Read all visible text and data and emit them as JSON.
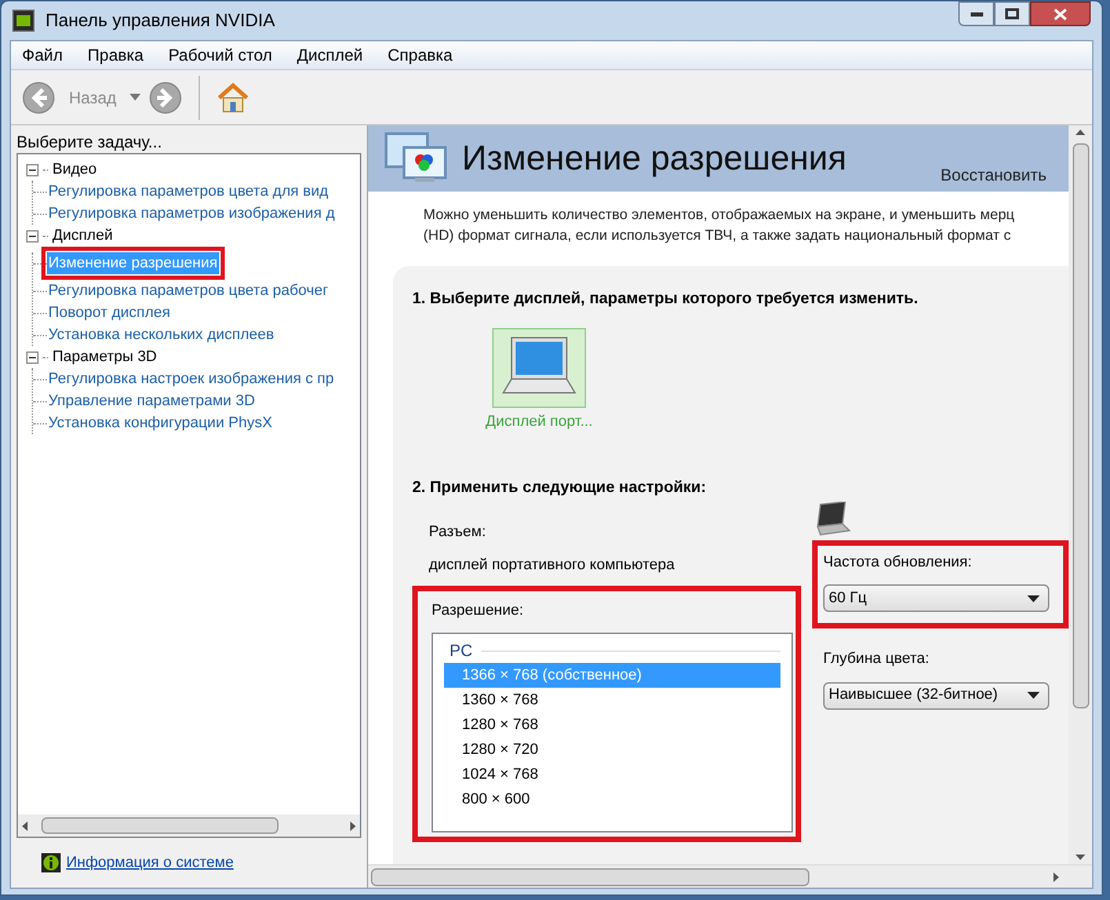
{
  "window": {
    "title": "Панель управления NVIDIA"
  },
  "menu": [
    "Файл",
    "Правка",
    "Рабочий стол",
    "Дисплей",
    "Справка"
  ],
  "toolbar": {
    "back_label": "Назад",
    "back_disabled": true
  },
  "sidebar": {
    "heading": "Выберите задачу...",
    "tree": [
      {
        "label": "Видео",
        "expanded": true,
        "children": [
          {
            "label": "Регулировка параметров цвета для вид",
            "selected": false
          },
          {
            "label": "Регулировка параметров изображения д",
            "selected": false
          }
        ]
      },
      {
        "label": "Дисплей",
        "expanded": true,
        "children": [
          {
            "label": "Изменение разрешения",
            "selected": true,
            "highlighted": true
          },
          {
            "label": "Регулировка параметров цвета рабочег",
            "selected": false
          },
          {
            "label": "Поворот дисплея",
            "selected": false
          },
          {
            "label": "Установка нескольких дисплеев",
            "selected": false
          }
        ]
      },
      {
        "label": "Параметры 3D",
        "expanded": true,
        "children": [
          {
            "label": "Регулировка настроек изображения с пр",
            "selected": false
          },
          {
            "label": "Управление параметрами 3D",
            "selected": false
          },
          {
            "label": "Установка конфигурации PhysX",
            "selected": false
          }
        ]
      }
    ],
    "footer_link": "Информация о системе"
  },
  "page": {
    "title": "Изменение разрешения",
    "restore_link": "Восстановить",
    "description": [
      "Можно уменьшить количество элементов, отображаемых на экране, и уменьшить мерц",
      "(HD) формат сигнала, если используется ТВЧ, а также задать национальный формат с"
    ],
    "step1": {
      "heading": "1. Выберите дисплей, параметры которого требуется изменить.",
      "displays": [
        {
          "label": "Дисплей порт...",
          "selected": true
        }
      ]
    },
    "step2": {
      "heading": "2. Применить следующие настройки:",
      "connector_label": "Разъем:",
      "connector_value": "дисплей портативного компьютера",
      "resolution": {
        "label": "Разрешение:",
        "highlighted": true,
        "group": "PC",
        "items": [
          {
            "label": "1366 × 768 (собственное)",
            "selected": true
          },
          {
            "label": "1360 × 768",
            "selected": false
          },
          {
            "label": "1280 × 768",
            "selected": false
          },
          {
            "label": "1280 × 720",
            "selected": false
          },
          {
            "label": "1024 × 768",
            "selected": false
          },
          {
            "label": "800 × 600",
            "selected": false
          }
        ]
      },
      "refresh": {
        "label": "Частота обновления:",
        "value": "60 Гц",
        "highlighted": true
      },
      "color_depth": {
        "label": "Глубина цвета:",
        "value": "Наивысшее (32-битное)"
      }
    }
  }
}
